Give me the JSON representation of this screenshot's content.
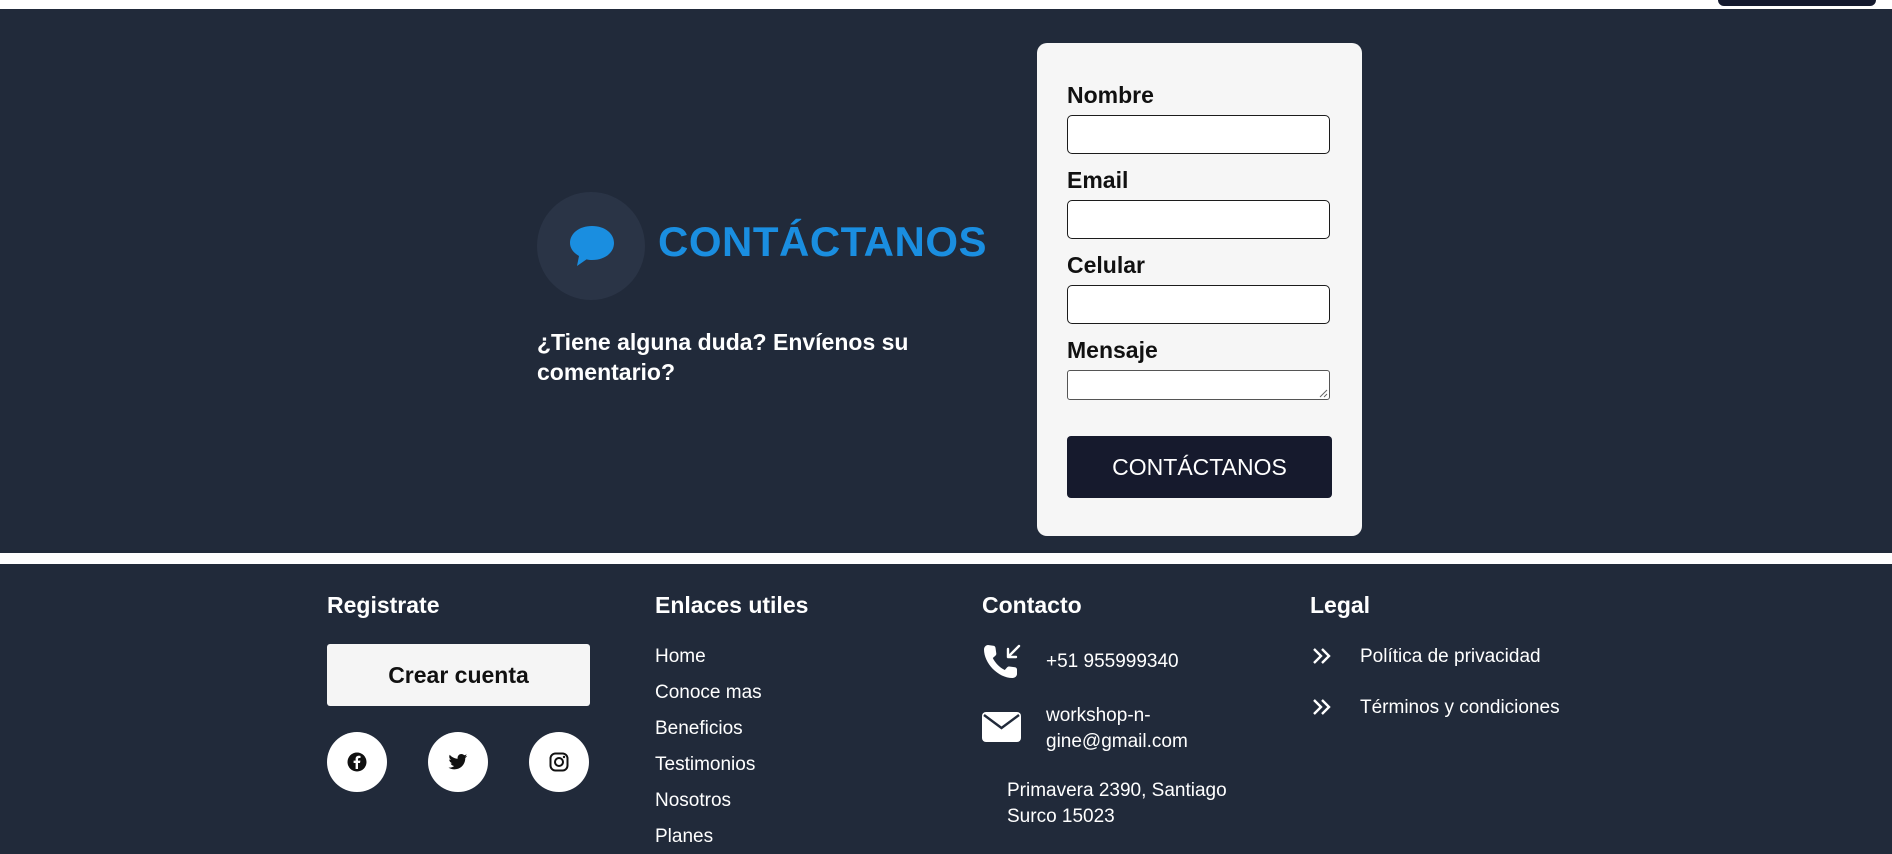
{
  "colors": {
    "background_dark": "#212a3a",
    "accent_blue": "#1a8ee0",
    "button_dark": "#161a2d",
    "card_bg": "#f6f6f6"
  },
  "contact": {
    "icon": "chat-bubble-icon",
    "title": "CONTÁCTANOS",
    "subtitle": "¿Tiene alguna duda? Envíenos su comentario?"
  },
  "form": {
    "fields": [
      {
        "label": "Nombre",
        "value": ""
      },
      {
        "label": "Email",
        "value": ""
      },
      {
        "label": "Celular",
        "value": ""
      },
      {
        "label": "Mensaje",
        "value": ""
      }
    ],
    "submit_label": "CONTÁCTANOS"
  },
  "footer": {
    "register": {
      "title": "Registrate",
      "button_label": "Crear cuenta",
      "social": [
        "facebook-icon",
        "twitter-icon",
        "instagram-icon"
      ]
    },
    "links": {
      "title": "Enlaces utiles",
      "items": [
        "Home",
        "Conoce mas",
        "Beneficios",
        "Testimonios",
        "Nosotros",
        "Planes"
      ]
    },
    "contact": {
      "title": "Contacto",
      "phone": "+51 955999340",
      "email_line1": "workshop-n-",
      "email_line2": "gine@gmail.com",
      "address_line1": "Primavera 2390, Santiago",
      "address_line2": "Surco 15023"
    },
    "legal": {
      "title": "Legal",
      "items": [
        "Política de privacidad",
        "Términos y condiciones"
      ]
    }
  }
}
